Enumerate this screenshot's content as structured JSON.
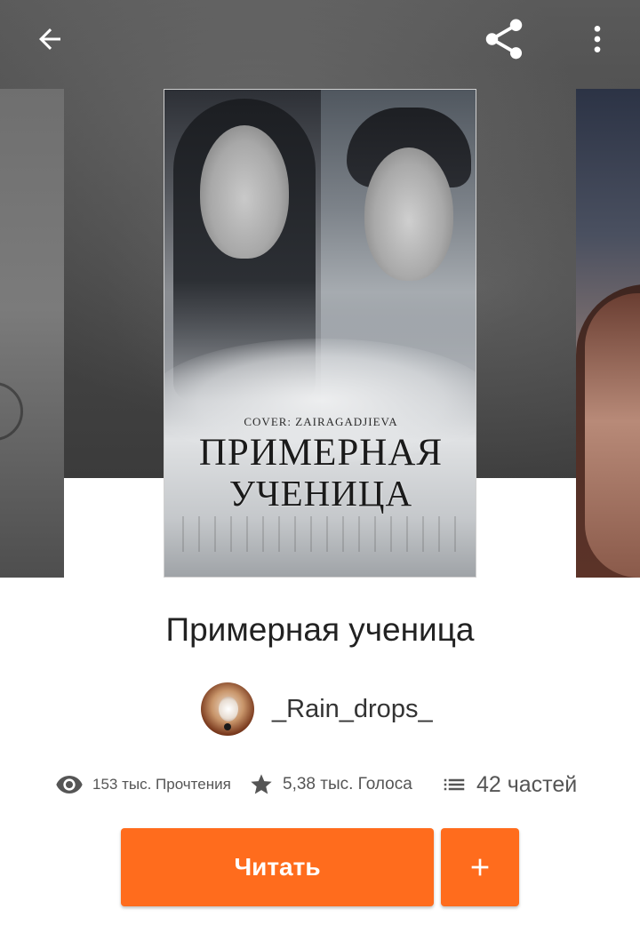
{
  "toolbar": {
    "back_icon": "arrow-left-icon",
    "share_icon": "share-icon",
    "more_icon": "more-vertical-icon"
  },
  "cover": {
    "credit": "COVER: ZAIRAGADJIEVA",
    "title_line1": "ПРИМЕРНАЯ",
    "title_line2": "УЧЕНИЦА"
  },
  "story": {
    "title": "Примерная ученица",
    "author": "_Rain_drops_"
  },
  "stats": {
    "reads": "153 тыс. Прочтения",
    "votes": "5,38 тыс. Голоса",
    "parts": "42 частей"
  },
  "actions": {
    "read_label": "Читать",
    "add_icon": "plus-icon"
  },
  "colors": {
    "accent": "#ff6c1d",
    "header_bg": "#4a4a4a",
    "text_primary": "#222222",
    "text_secondary": "#555555"
  }
}
